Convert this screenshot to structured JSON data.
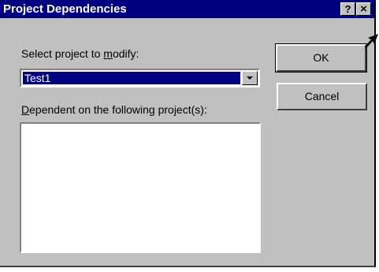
{
  "dialog": {
    "title": "Project Dependencies",
    "help_label": "?",
    "close_label": "×"
  },
  "select_project": {
    "label_prefix": "Select project to ",
    "label_accel": "m",
    "label_suffix": "odify:",
    "value": "Test1"
  },
  "dependent": {
    "label_accel": "D",
    "label_rest": "ependent on the following project(s):",
    "items": []
  },
  "buttons": {
    "ok_label": "OK",
    "cancel_label": "Cancel"
  },
  "colors": {
    "titlebar": "#000080",
    "face": "#c0c0c0",
    "selection": "#000080"
  },
  "icons": {
    "dropdown": "chevron-down-icon",
    "pointer": "mouse-pointer-icon"
  }
}
